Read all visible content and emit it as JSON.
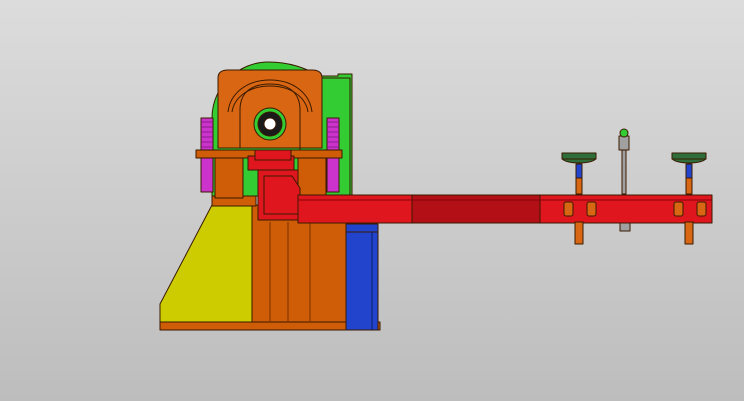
{
  "viewport": {
    "background_top": "#dcdcdc",
    "background_bottom": "#bdbdbd"
  },
  "model": {
    "parts": [
      {
        "name": "base-frame",
        "color": "#cf5c06"
      },
      {
        "name": "support-plate",
        "color": "#cccc00"
      },
      {
        "name": "gear-housing",
        "color": "#33cc33"
      },
      {
        "name": "pulley-housing",
        "color": "#d86612"
      },
      {
        "name": "bearing",
        "color": "#1a1a1a"
      },
      {
        "name": "bearing-ring",
        "color": "#33cc33"
      },
      {
        "name": "compression-springs",
        "color": "#cc33cc"
      },
      {
        "name": "slide-block",
        "color": "#e0161f"
      },
      {
        "name": "beam-arm",
        "color": "#e0161f"
      },
      {
        "name": "beam-dark-section",
        "color": "#b30f17"
      },
      {
        "name": "blue-column",
        "color": "#2244cc"
      },
      {
        "name": "sheave-wheels",
        "color": "#2f6e3a"
      },
      {
        "name": "bolts",
        "color": "#d86612"
      },
      {
        "name": "sensor-rod",
        "color": "#a0a0a0"
      }
    ]
  }
}
